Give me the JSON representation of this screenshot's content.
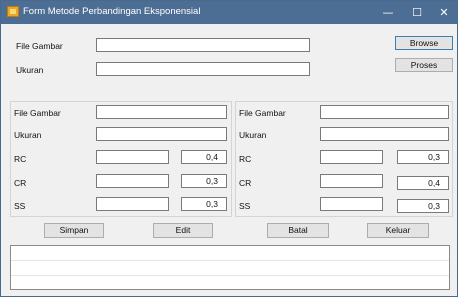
{
  "window": {
    "title": "Form Metode Perbandingan Eksponensial",
    "minimize_glyph": "—",
    "maximize_glyph": "☐",
    "close_glyph": "✕"
  },
  "top": {
    "file_label": "File Gambar",
    "size_label": "Ukuran",
    "file_value": "",
    "size_value": "",
    "browse_label": "Browse",
    "process_label": "Proses"
  },
  "left_panel": {
    "file_label": "File Gambar",
    "size_label": "Ukuran",
    "rc_label": "RC",
    "cr_label": "CR",
    "ss_label": "SS",
    "file_value": "",
    "size_value": "",
    "rc_value": "",
    "cr_value": "",
    "ss_value": "",
    "rc_weight": "0,4",
    "cr_weight": "0,3",
    "ss_weight": "0,3"
  },
  "right_panel": {
    "file_label": "File Gambar",
    "size_label": "Ukuran",
    "rc_label": "RC",
    "cr_label": "CR",
    "ss_label": "SS",
    "file_value": "",
    "size_value": "",
    "rc_value": "",
    "cr_value": "",
    "ss_value": "",
    "rc_weight": "0,3",
    "cr_weight": "0,4",
    "ss_weight": "0,3"
  },
  "actions": {
    "save_label": "Simpan",
    "edit_label": "Edit",
    "cancel_label": "Batal",
    "exit_label": "Keluar"
  },
  "colors": {
    "titlebar": "#4d6e94",
    "window_bg": "#f0f0f0",
    "default_button_border": "#3c7fb1"
  }
}
